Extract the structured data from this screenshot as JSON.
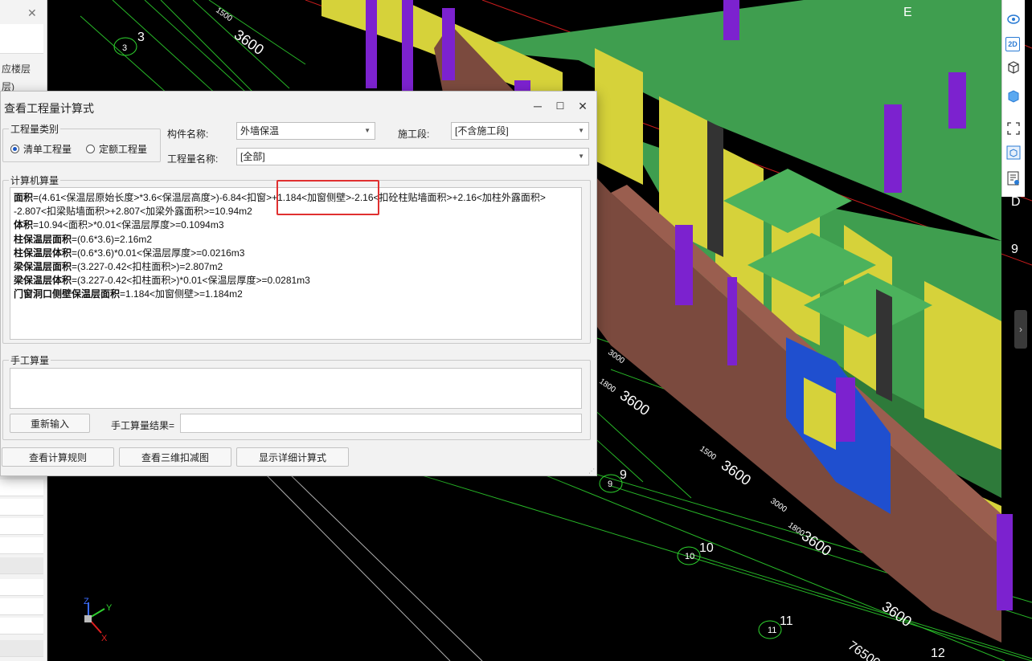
{
  "colors": {
    "accent": "#1a56c4",
    "highlight": "#e03030",
    "wall_green": "#3f9e4f",
    "wall_yellow": "#d6d23a",
    "column_purple": "#7c22cf",
    "beam_brown": "#7b4a3e",
    "selected_blue": "#1f4fcf",
    "grid_green": "#2fd82f"
  },
  "left_panel": {
    "close": "✕",
    "text1": "应楼层",
    "text2": "层)"
  },
  "dialog": {
    "title": "查看工程量计算式",
    "window_buttons": {
      "minimize": "─",
      "maximize": "☐",
      "close": "✕"
    },
    "quantity_type": {
      "legend": "工程量类别",
      "option_bill": "清单工程量",
      "option_quota": "定额工程量",
      "selected": "清单工程量"
    },
    "component_name": {
      "label": "构件名称:",
      "value": "外墙保温"
    },
    "construction_stage": {
      "label": "施工段:",
      "value": "[不含施工段]"
    },
    "quantity_name": {
      "label": "工程量名称:",
      "value": "[全部]"
    },
    "computer_calc": {
      "legend": "计算机算量",
      "lines": [
        {
          "key": "面积",
          "text": "=(4.61<保温层原始长度>*3.6<保温层高度>)-6.84<扣窗>+1.184<加窗侧壁>-2.16<扣砼柱贴墙面积>+2.16<加柱外露面积>"
        },
        {
          "key": "",
          "text": "-2.807<扣梁贴墙面积>+2.807<加梁外露面积>=10.94m2"
        },
        {
          "key": "体积",
          "text": "=10.94<面积>*0.01<保温层厚度>=0.1094m3"
        },
        {
          "key": "柱保温层面积",
          "text": "=(0.6*3.6)=2.16m2"
        },
        {
          "key": "柱保温层体积",
          "text": "=(0.6*3.6)*0.01<保温层厚度>=0.0216m3"
        },
        {
          "key": "梁保温层面积",
          "text": "=(3.227-0.42<扣柱面积>)=2.807m2"
        },
        {
          "key": "梁保温层体积",
          "text": "=(3.227-0.42<扣柱面积>)*0.01<保温层厚度>=0.0281m3"
        },
        {
          "key": "门窗洞口侧壁保温层面积",
          "text": "=1.184<加窗侧壁>=1.184m2"
        }
      ]
    },
    "manual_calc": {
      "legend": "手工算量",
      "reinput": "重新输入",
      "result_label": "手工算量结果="
    },
    "buttons": {
      "rules": "查看计算规则",
      "view3d": "查看三维扣减图",
      "detail": "显示详细计算式"
    }
  },
  "drawing": {
    "axis_labels": [
      "3",
      "3",
      "9",
      "9",
      "10",
      "10",
      "11",
      "11",
      "12",
      "E",
      "D",
      "9"
    ],
    "dims": [
      "3600",
      "1500",
      "3600",
      "1800",
      "3600",
      "3600",
      "1500",
      "1800",
      "3600",
      "3600",
      "3600",
      "1500",
      "3600",
      "3600",
      "76500",
      "3000",
      "3000"
    ],
    "axis_triad": {
      "x": "X",
      "y": "Y",
      "z": "Z"
    }
  },
  "right_toolbar": {
    "icons": [
      "orbit-icon",
      "2d-icon",
      "cube-icon",
      "cube-solid-icon",
      "fit-view-icon",
      "3d-box-icon",
      "properties-icon"
    ],
    "tb_2d": "2D",
    "scroll": "›"
  }
}
